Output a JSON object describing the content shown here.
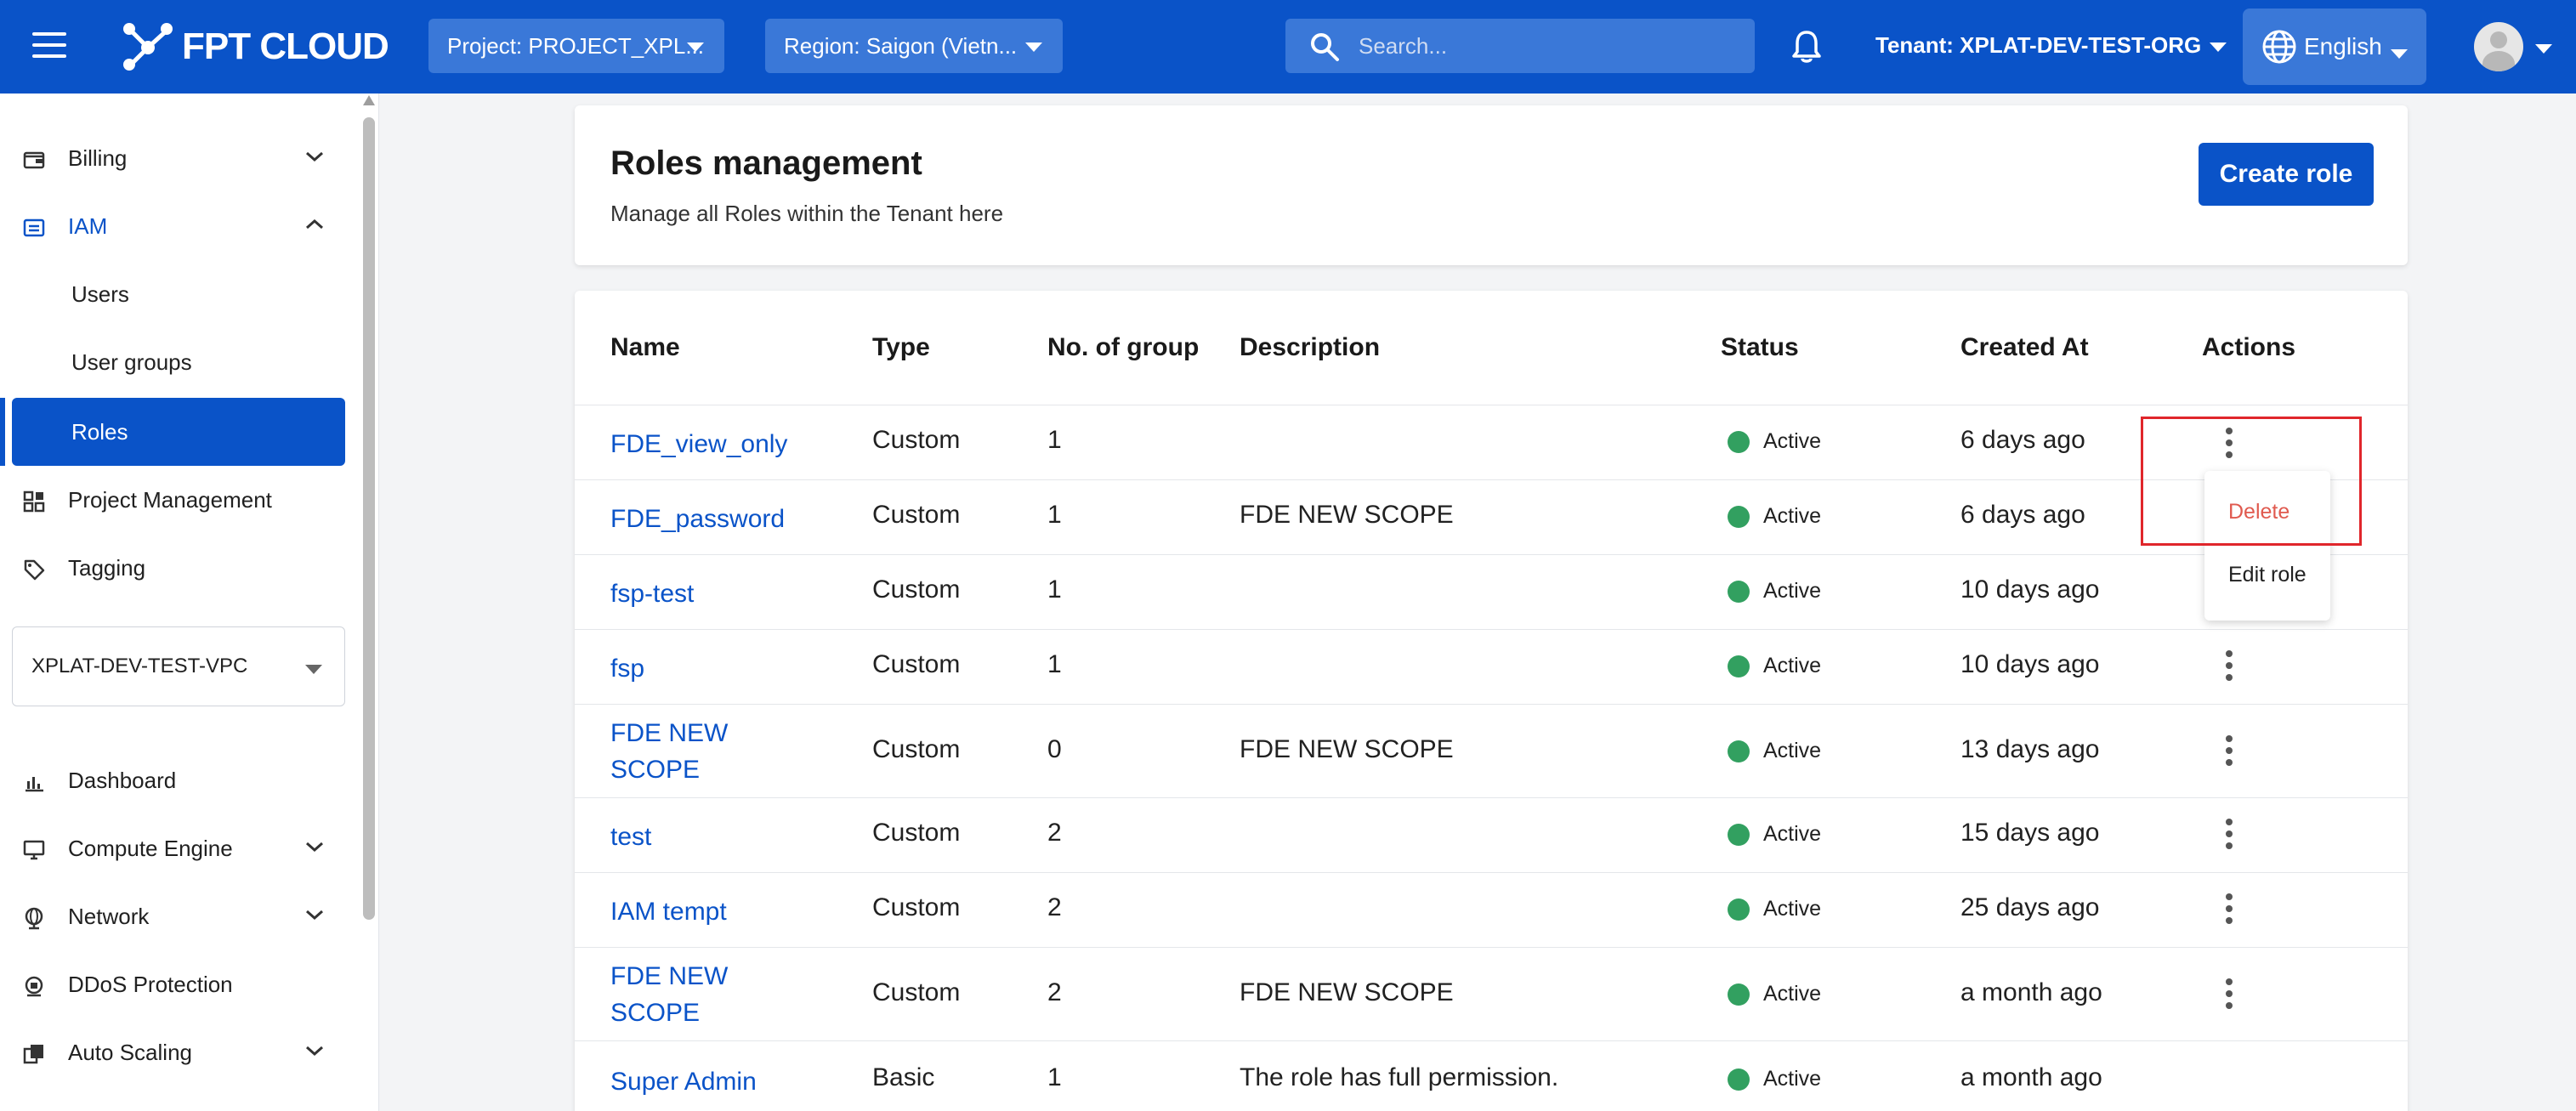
{
  "header": {
    "logo_text": "FPT CLOUD",
    "project_label": "Project: PROJECT_XPL...",
    "region_label": "Region: Saigon (Vietn...",
    "search_placeholder": "Search...",
    "tenant_label": "Tenant: XPLAT-DEV-TEST-ORG",
    "language_label": "English",
    "brand_color": "#0a53c8"
  },
  "sidebar": {
    "billing": "Billing",
    "iam": "IAM",
    "users": "Users",
    "user_groups": "User groups",
    "roles": "Roles",
    "project_management": "Project Management",
    "tagging": "Tagging",
    "vpc_selected": "XPLAT-DEV-TEST-VPC",
    "dashboard": "Dashboard",
    "compute_engine": "Compute Engine",
    "network": "Network",
    "ddos_protection": "DDoS Protection",
    "auto_scaling": "Auto Scaling"
  },
  "page": {
    "title": "Roles management",
    "subtitle": "Manage all Roles within the Tenant here",
    "create_button": "Create role"
  },
  "table": {
    "columns": [
      "Name",
      "Type",
      "No. of group",
      "Description",
      "Status",
      "Created At",
      "Actions"
    ],
    "rows": [
      {
        "name": "FDE_view_only",
        "type": "Custom",
        "groups": "1",
        "description": "",
        "status": "Active",
        "created": "6 days ago"
      },
      {
        "name": "FDE_password",
        "type": "Custom",
        "groups": "1",
        "description": "FDE NEW SCOPE",
        "status": "Active",
        "created": "6 days ago"
      },
      {
        "name": "fsp-test",
        "type": "Custom",
        "groups": "1",
        "description": "",
        "status": "Active",
        "created": "10 days ago"
      },
      {
        "name": "fsp",
        "type": "Custom",
        "groups": "1",
        "description": "",
        "status": "Active",
        "created": "10 days ago"
      },
      {
        "name": "FDE NEW SCOPE",
        "type": "Custom",
        "groups": "0",
        "description": "FDE NEW SCOPE",
        "status": "Active",
        "created": "13 days ago"
      },
      {
        "name": "test",
        "type": "Custom",
        "groups": "2",
        "description": "",
        "status": "Active",
        "created": "15 days ago"
      },
      {
        "name": "IAM tempt",
        "type": "Custom",
        "groups": "2",
        "description": "",
        "status": "Active",
        "created": "25 days ago"
      },
      {
        "name": "FDE NEW SCOPE",
        "type": "Custom",
        "groups": "2",
        "description": "FDE NEW SCOPE",
        "status": "Active",
        "created": "a month ago"
      },
      {
        "name": "Super Admin",
        "type": "Basic",
        "groups": "1",
        "description": "The role has full permission.",
        "status": "Active",
        "created": "a month ago"
      }
    ],
    "status_color": "#32a060"
  },
  "action_menu": {
    "delete": "Delete",
    "edit": "Edit role"
  }
}
